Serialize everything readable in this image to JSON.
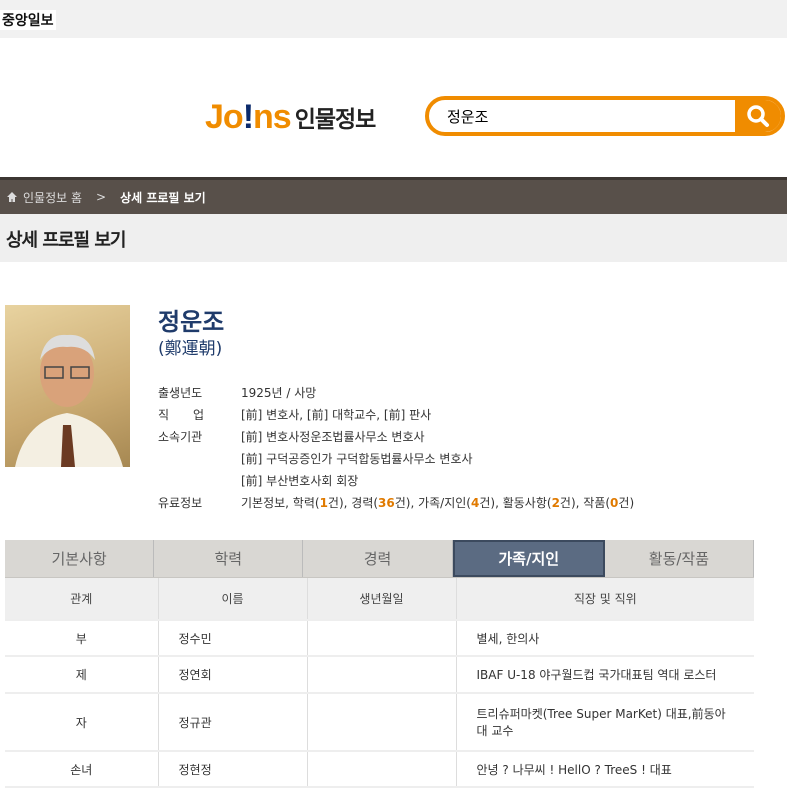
{
  "topbar": {
    "brand": "중앙일보"
  },
  "logo": {
    "joins_a": "Jo",
    "joins_ex": "!",
    "joins_b": "ns",
    "sub": "인물정보"
  },
  "search": {
    "value": "정운조"
  },
  "breadcrumb": {
    "home": "인물정보 홈",
    "sep": ">",
    "current": "상세 프로필 보기"
  },
  "page_title": "상세 프로필 보기",
  "profile": {
    "name": "정운조",
    "hanja": "(鄭運朝)",
    "rows": [
      {
        "label": "출생년도",
        "value": "1925년 / 사망"
      },
      {
        "label": "직　　업",
        "value": "[前] 변호사, [前] 대학교수, [前] 판사"
      },
      {
        "label": "소속기관",
        "value": "[前] 변호사정운조법률사무소 변호사"
      },
      {
        "label": "",
        "value": "[前] 구덕공증인가 구덕합동법률사무소 변호사"
      },
      {
        "label": "",
        "value": "[前] 부산변호사회 회장"
      }
    ],
    "paid": {
      "label": "유료정보",
      "t0": "기본정보, 학력(",
      "n1": "1",
      "t1": "건), 경력(",
      "n2": "36",
      "t2": "건), 가족/지인(",
      "n3": "4",
      "t3": "건), 활동사항(",
      "n4": "2",
      "t4": "건), 작품(",
      "n5": "0",
      "t5": "건)"
    }
  },
  "tabs": [
    "기본사항",
    "학력",
    "경력",
    "가족/지인",
    "활동/작품"
  ],
  "active_tab": "가족/지인",
  "table": {
    "headers": [
      "관계",
      "이름",
      "생년월일",
      "직장 및 직위"
    ],
    "rows": [
      [
        "부",
        "정수민",
        "",
        "별세, 한의사"
      ],
      [
        "제",
        "정연회",
        "",
        "IBAF U-18 야구월드컵 국가대표팀 역대 로스터"
      ],
      [
        "자",
        "정규관",
        "",
        "트리슈퍼마켓(Tree Super MarKet) 대표,前동아대 교수"
      ],
      [
        "손녀",
        "정현정",
        "",
        "안녕 ? 나무씨 ! HellO ? TreeS ! 대표"
      ]
    ]
  },
  "colors": {
    "accent": "#f08c00",
    "breadcrumb_bg": "#58504a",
    "active_tab": "#5b6b82",
    "highlight": "#e07a00"
  }
}
